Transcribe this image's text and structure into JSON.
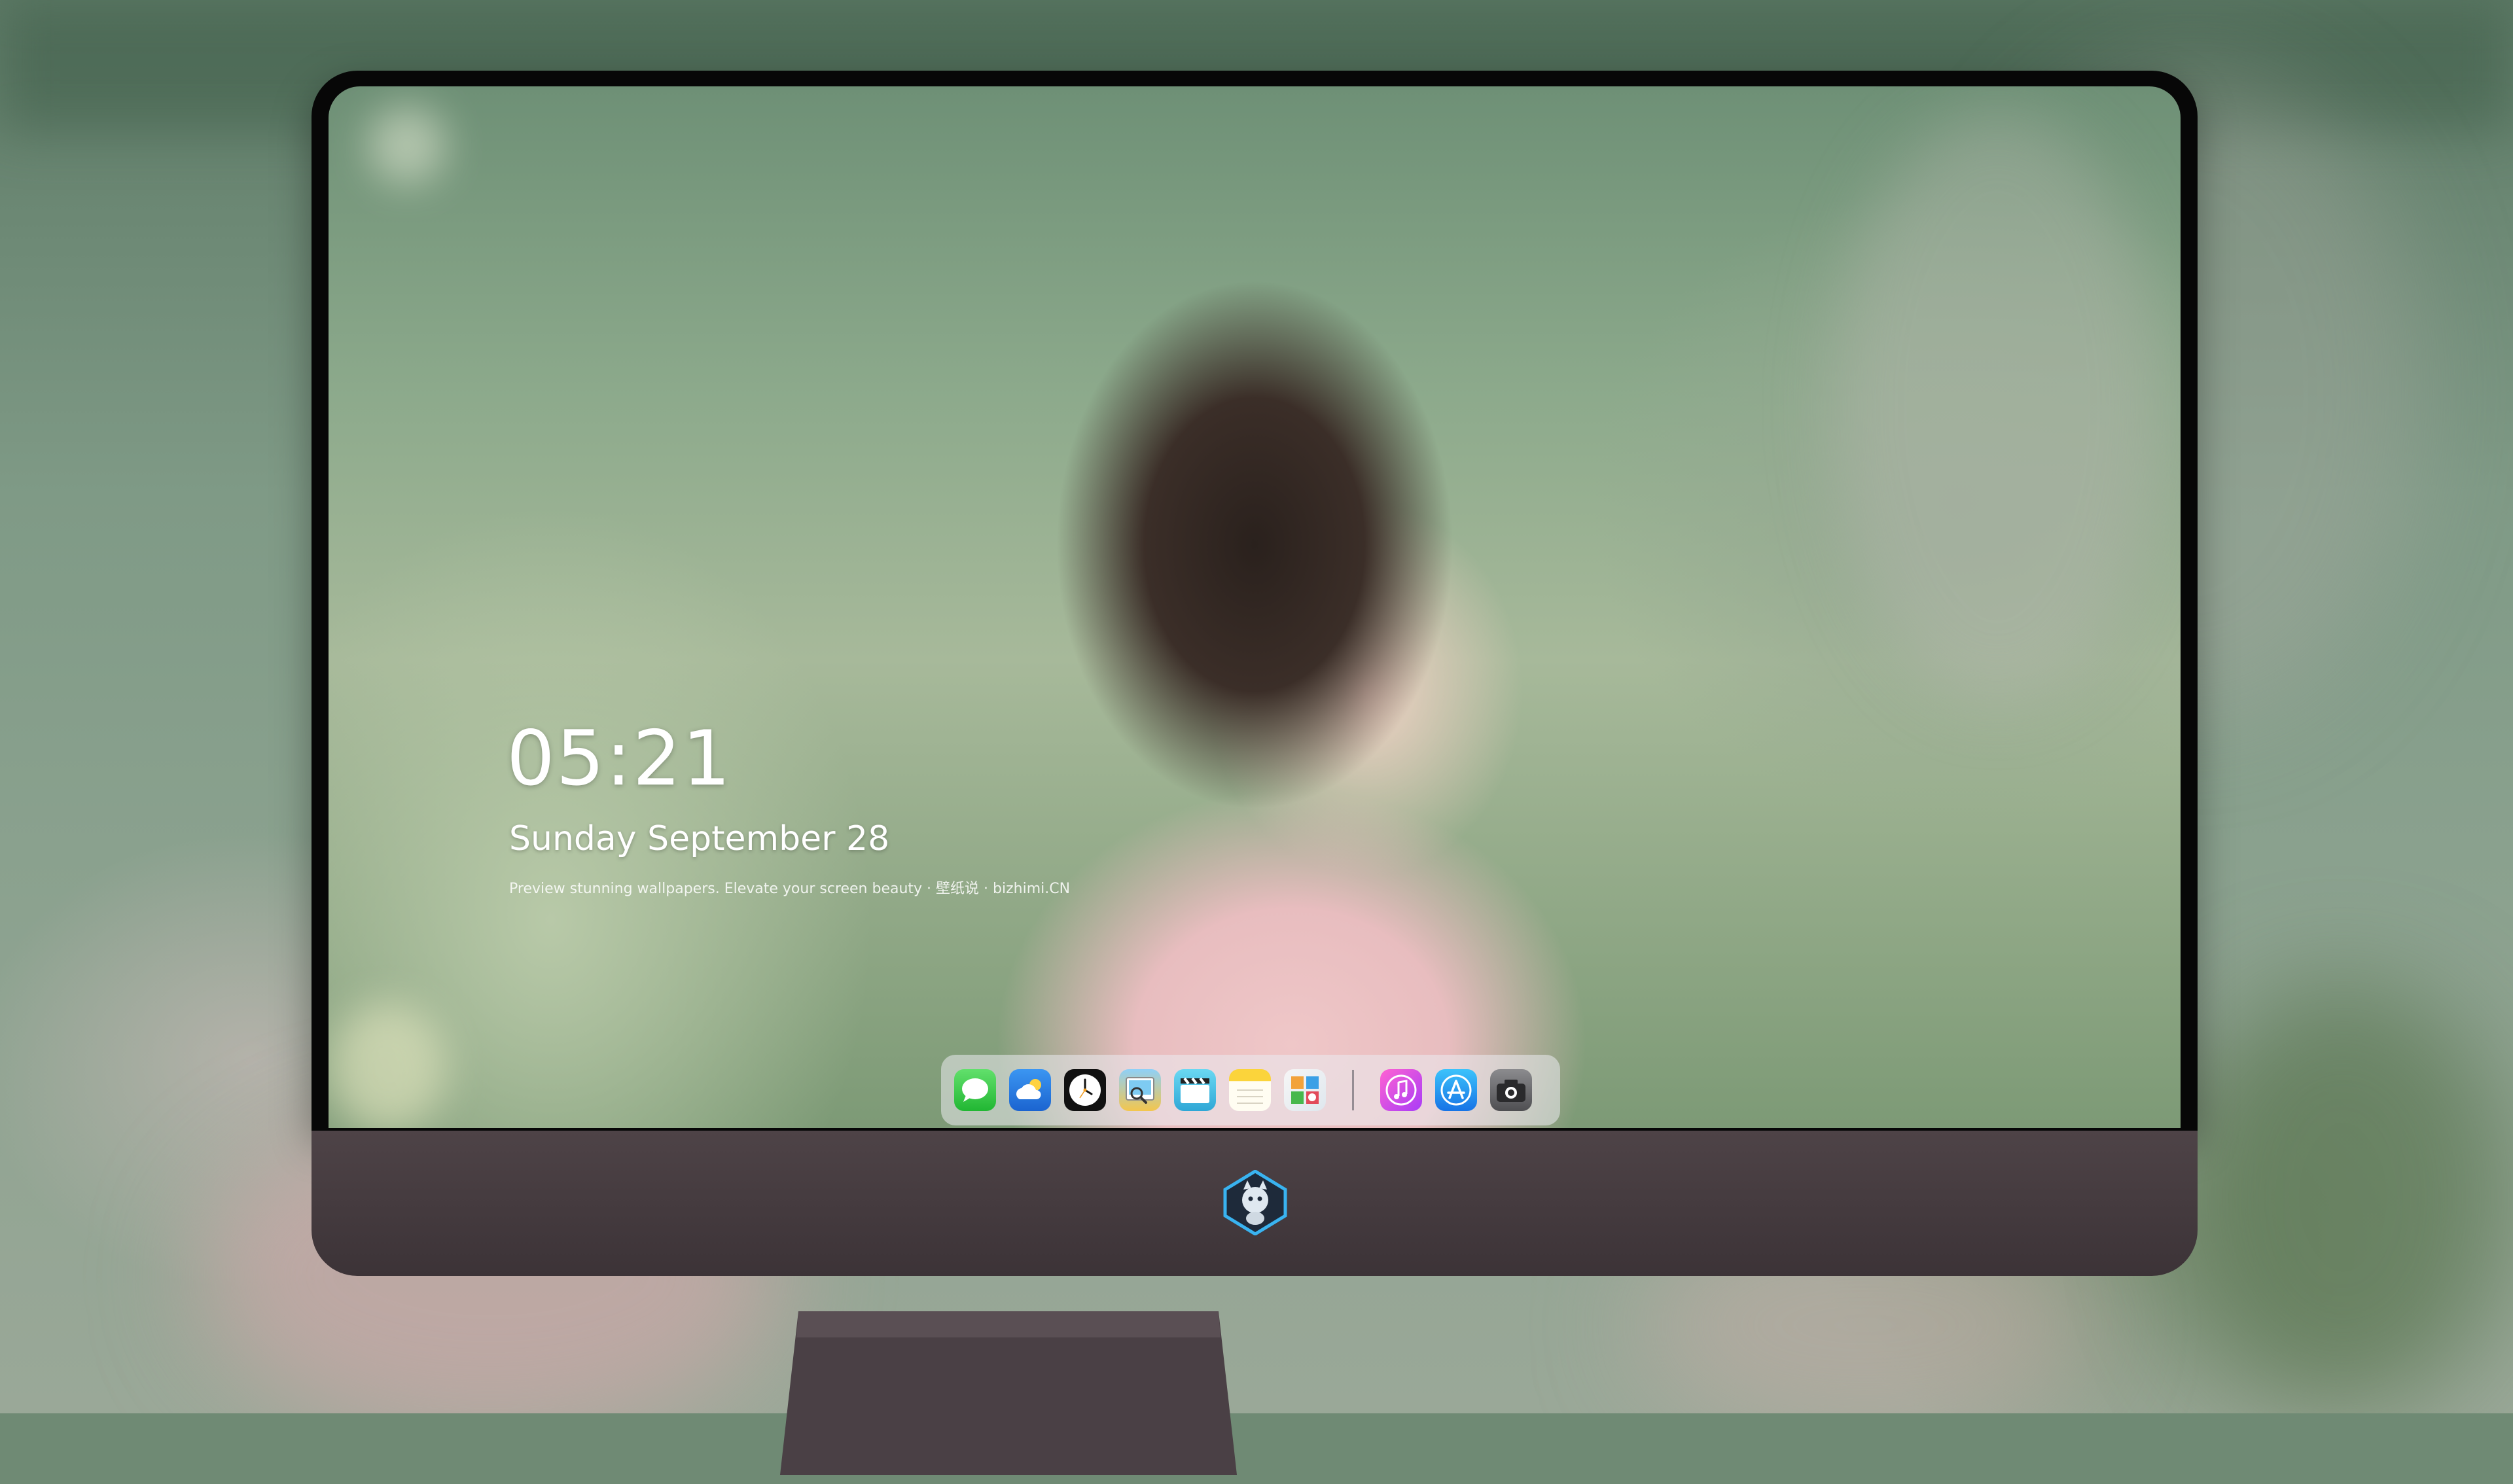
{
  "lock_screen": {
    "time": "05:21",
    "date": "Sunday September  28",
    "tagline": "Preview stunning wallpapers. Elevate your screen beauty · 壁纸说 · bizhimi.CN"
  },
  "dock": {
    "apps": [
      {
        "name": "Messages",
        "icon": "message-bubble-icon"
      },
      {
        "name": "Weather",
        "icon": "cloud-sun-icon"
      },
      {
        "name": "Clock",
        "icon": "clock-icon"
      },
      {
        "name": "Preview",
        "icon": "preview-icon"
      },
      {
        "name": "Clips",
        "icon": "clapperboard-icon"
      },
      {
        "name": "Notes",
        "icon": "notes-icon"
      },
      {
        "name": "Photo Booth",
        "icon": "photo-grid-icon"
      },
      {
        "name": "Music",
        "icon": "music-note-icon"
      },
      {
        "name": "App Store",
        "icon": "app-store-icon"
      },
      {
        "name": "Camera",
        "icon": "camera-icon"
      }
    ]
  },
  "colors": {
    "bezel": "#070707",
    "chin": "#4e4347",
    "dock_background": "rgba(235,235,240,0.55)",
    "clock_text": "#ffffff"
  }
}
